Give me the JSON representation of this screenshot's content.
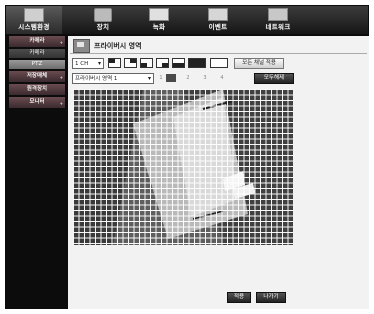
{
  "tabs": [
    {
      "label": "시스템환경",
      "icon": "system-icon",
      "active": true
    },
    {
      "label": "장치",
      "icon": "camera-icon",
      "active": false
    },
    {
      "label": "녹화",
      "icon": "record-icon",
      "active": false
    },
    {
      "label": "이벤트",
      "icon": "event-icon",
      "active": false
    },
    {
      "label": "네트워크",
      "icon": "network-icon",
      "active": false
    }
  ],
  "sidebar": {
    "items": [
      {
        "label": "카메라",
        "mark": "+"
      },
      {
        "label": "카메라",
        "sub": true
      },
      {
        "label": "PTZ",
        "sub": true
      },
      {
        "label": "저장매체",
        "mark": "+"
      },
      {
        "label": "원격장치",
        "mark": ""
      },
      {
        "label": "모니터",
        "mark": "+"
      }
    ]
  },
  "page": {
    "title": "프라이버시 영역",
    "channel_select": "1 CH",
    "apply_all_channels": "모든 채널 적용",
    "privacy_select": "프라이버시 영역 1",
    "clear_all": "모두해제",
    "zone_numbers": [
      "1",
      "2",
      "3",
      "4"
    ],
    "apply_button": "적용",
    "exit_button": "나가기"
  },
  "colors": {
    "tab_active": "#4a4a4a",
    "sidebar_accent": "#5a3f44",
    "panel_bg": "#f2f2f2",
    "grid_line": "#ffffff"
  }
}
